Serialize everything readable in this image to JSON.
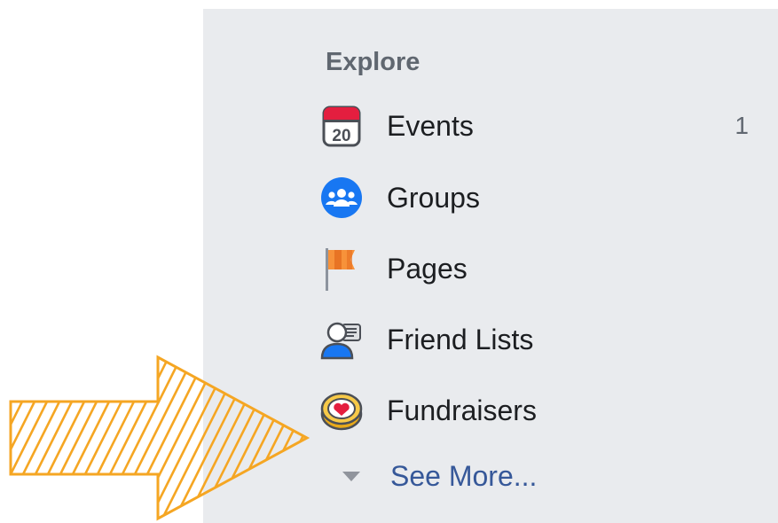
{
  "explore": {
    "heading": "Explore",
    "items": [
      {
        "label": "Events",
        "count": "1",
        "icon": "calendar-icon",
        "calendar_day": "20"
      },
      {
        "label": "Groups",
        "count": "",
        "icon": "groups-icon"
      },
      {
        "label": "Pages",
        "count": "",
        "icon": "flag-icon"
      },
      {
        "label": "Friend Lists",
        "count": "",
        "icon": "friend-list-icon"
      },
      {
        "label": "Fundraisers",
        "count": "",
        "icon": "fundraiser-heart-coin-icon"
      }
    ],
    "see_more": {
      "label": "See More...",
      "icon": "caret-down-icon"
    }
  },
  "annotation": {
    "icon": "hatched-arrow-icon",
    "color": "#f5a623"
  },
  "colors": {
    "panel_background": "#e9ebee",
    "link": "#365899",
    "text": "#1c1e21",
    "muted": "#606770"
  }
}
